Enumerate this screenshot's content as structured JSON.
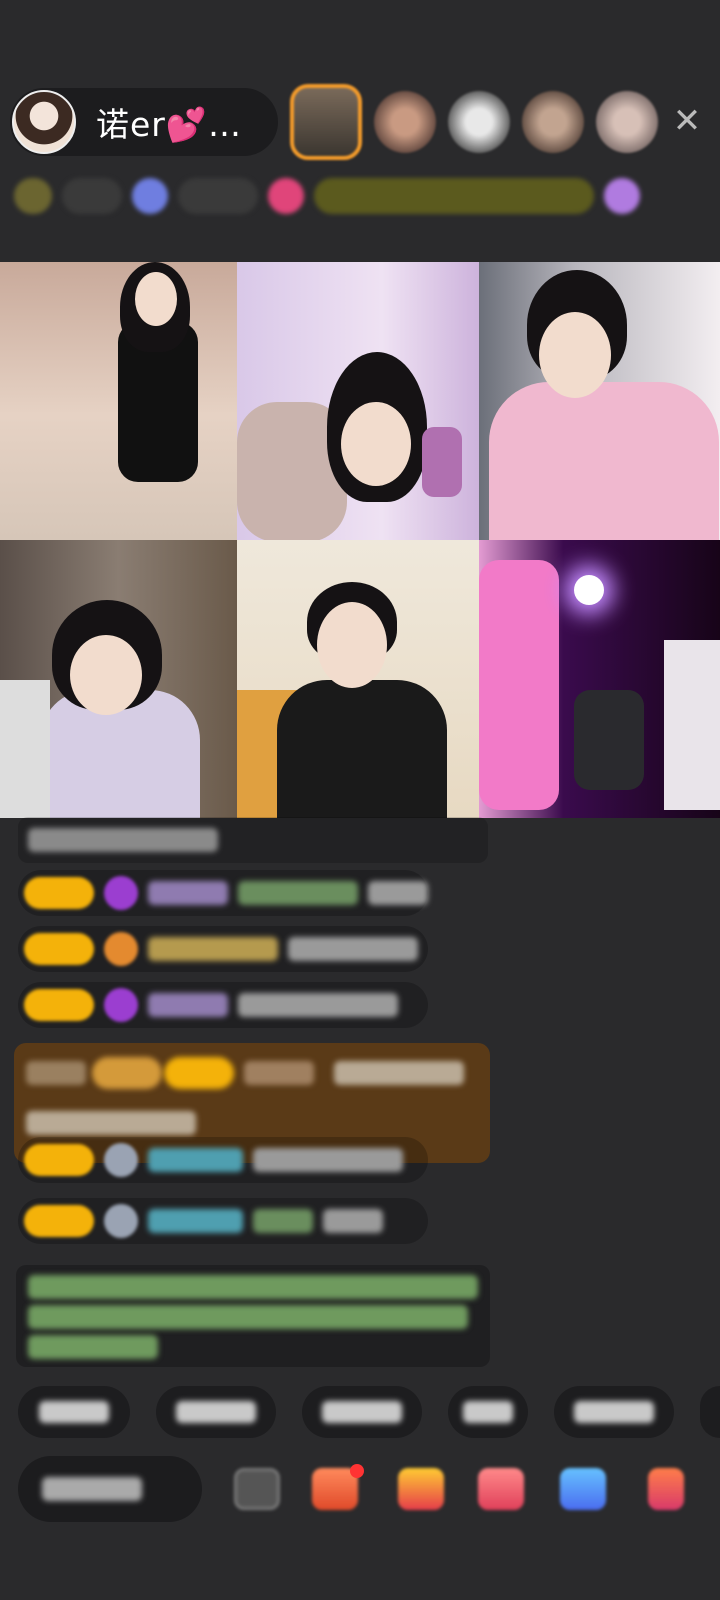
{
  "header": {
    "host_name": "诺er💕…",
    "close_icon": "close-icon"
  },
  "colors": {
    "background": "#2a2a2c",
    "badge_yellow": "#f4b20a",
    "gift_banner": "#5a3a17",
    "viewer_highlight": "#f39b2b"
  },
  "video_grid": {
    "tiles": 6
  }
}
